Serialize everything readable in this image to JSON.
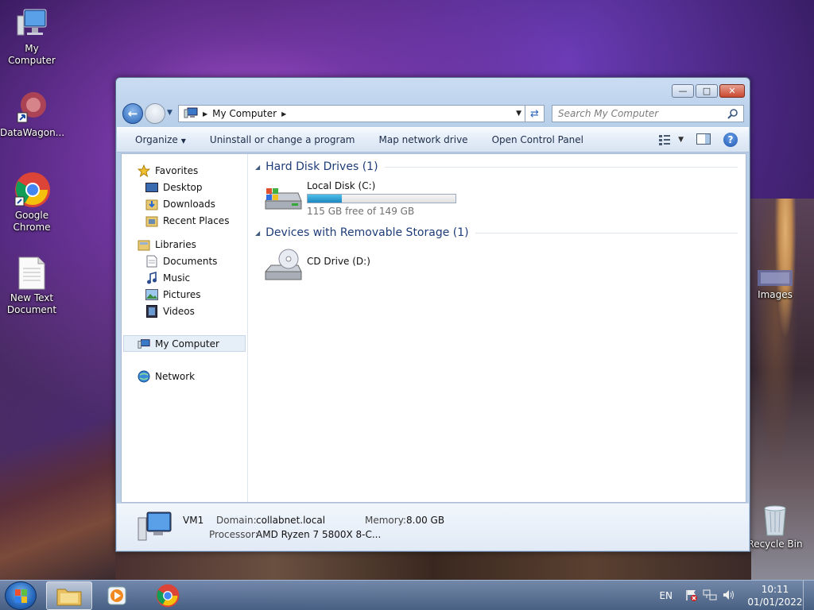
{
  "desktop": {
    "icons": [
      {
        "label": "My Computer"
      },
      {
        "label": "DataWagon..."
      },
      {
        "label": "Google Chrome"
      },
      {
        "label": "New Text Document"
      },
      {
        "label": "Images"
      },
      {
        "label": "Recycle Bin"
      }
    ]
  },
  "window": {
    "address": {
      "crumb": "My Computer"
    },
    "search": {
      "placeholder": "Search My Computer"
    },
    "toolbar": {
      "organize": "Organize",
      "uninstall": "Uninstall or change a program",
      "map_drive": "Map network drive",
      "control_panel": "Open Control Panel"
    },
    "nav": {
      "favorites": "Favorites",
      "desktop": "Desktop",
      "downloads": "Downloads",
      "recent": "Recent Places",
      "libraries": "Libraries",
      "documents": "Documents",
      "music": "Music",
      "pictures": "Pictures",
      "videos": "Videos",
      "my_computer": "My Computer",
      "network": "Network"
    },
    "groups": {
      "hdd": "Hard Disk Drives (1)",
      "removable": "Devices with Removable Storage (1)"
    },
    "drives": {
      "c_name": "Local Disk (C:)",
      "c_free": "115 GB free of 149 GB",
      "c_used_fraction": 0.23,
      "d_name": "CD Drive (D:)"
    },
    "details": {
      "name": "VM1",
      "domain_label": "Domain:",
      "domain": "collabnet.local",
      "memory_label": "Memory:",
      "memory": "8.00 GB",
      "processor_label": "Processor:",
      "processor": "AMD Ryzen 7 5800X 8-C..."
    }
  },
  "taskbar": {
    "lang": "EN",
    "time": "10:11",
    "date": "01/01/2022"
  }
}
